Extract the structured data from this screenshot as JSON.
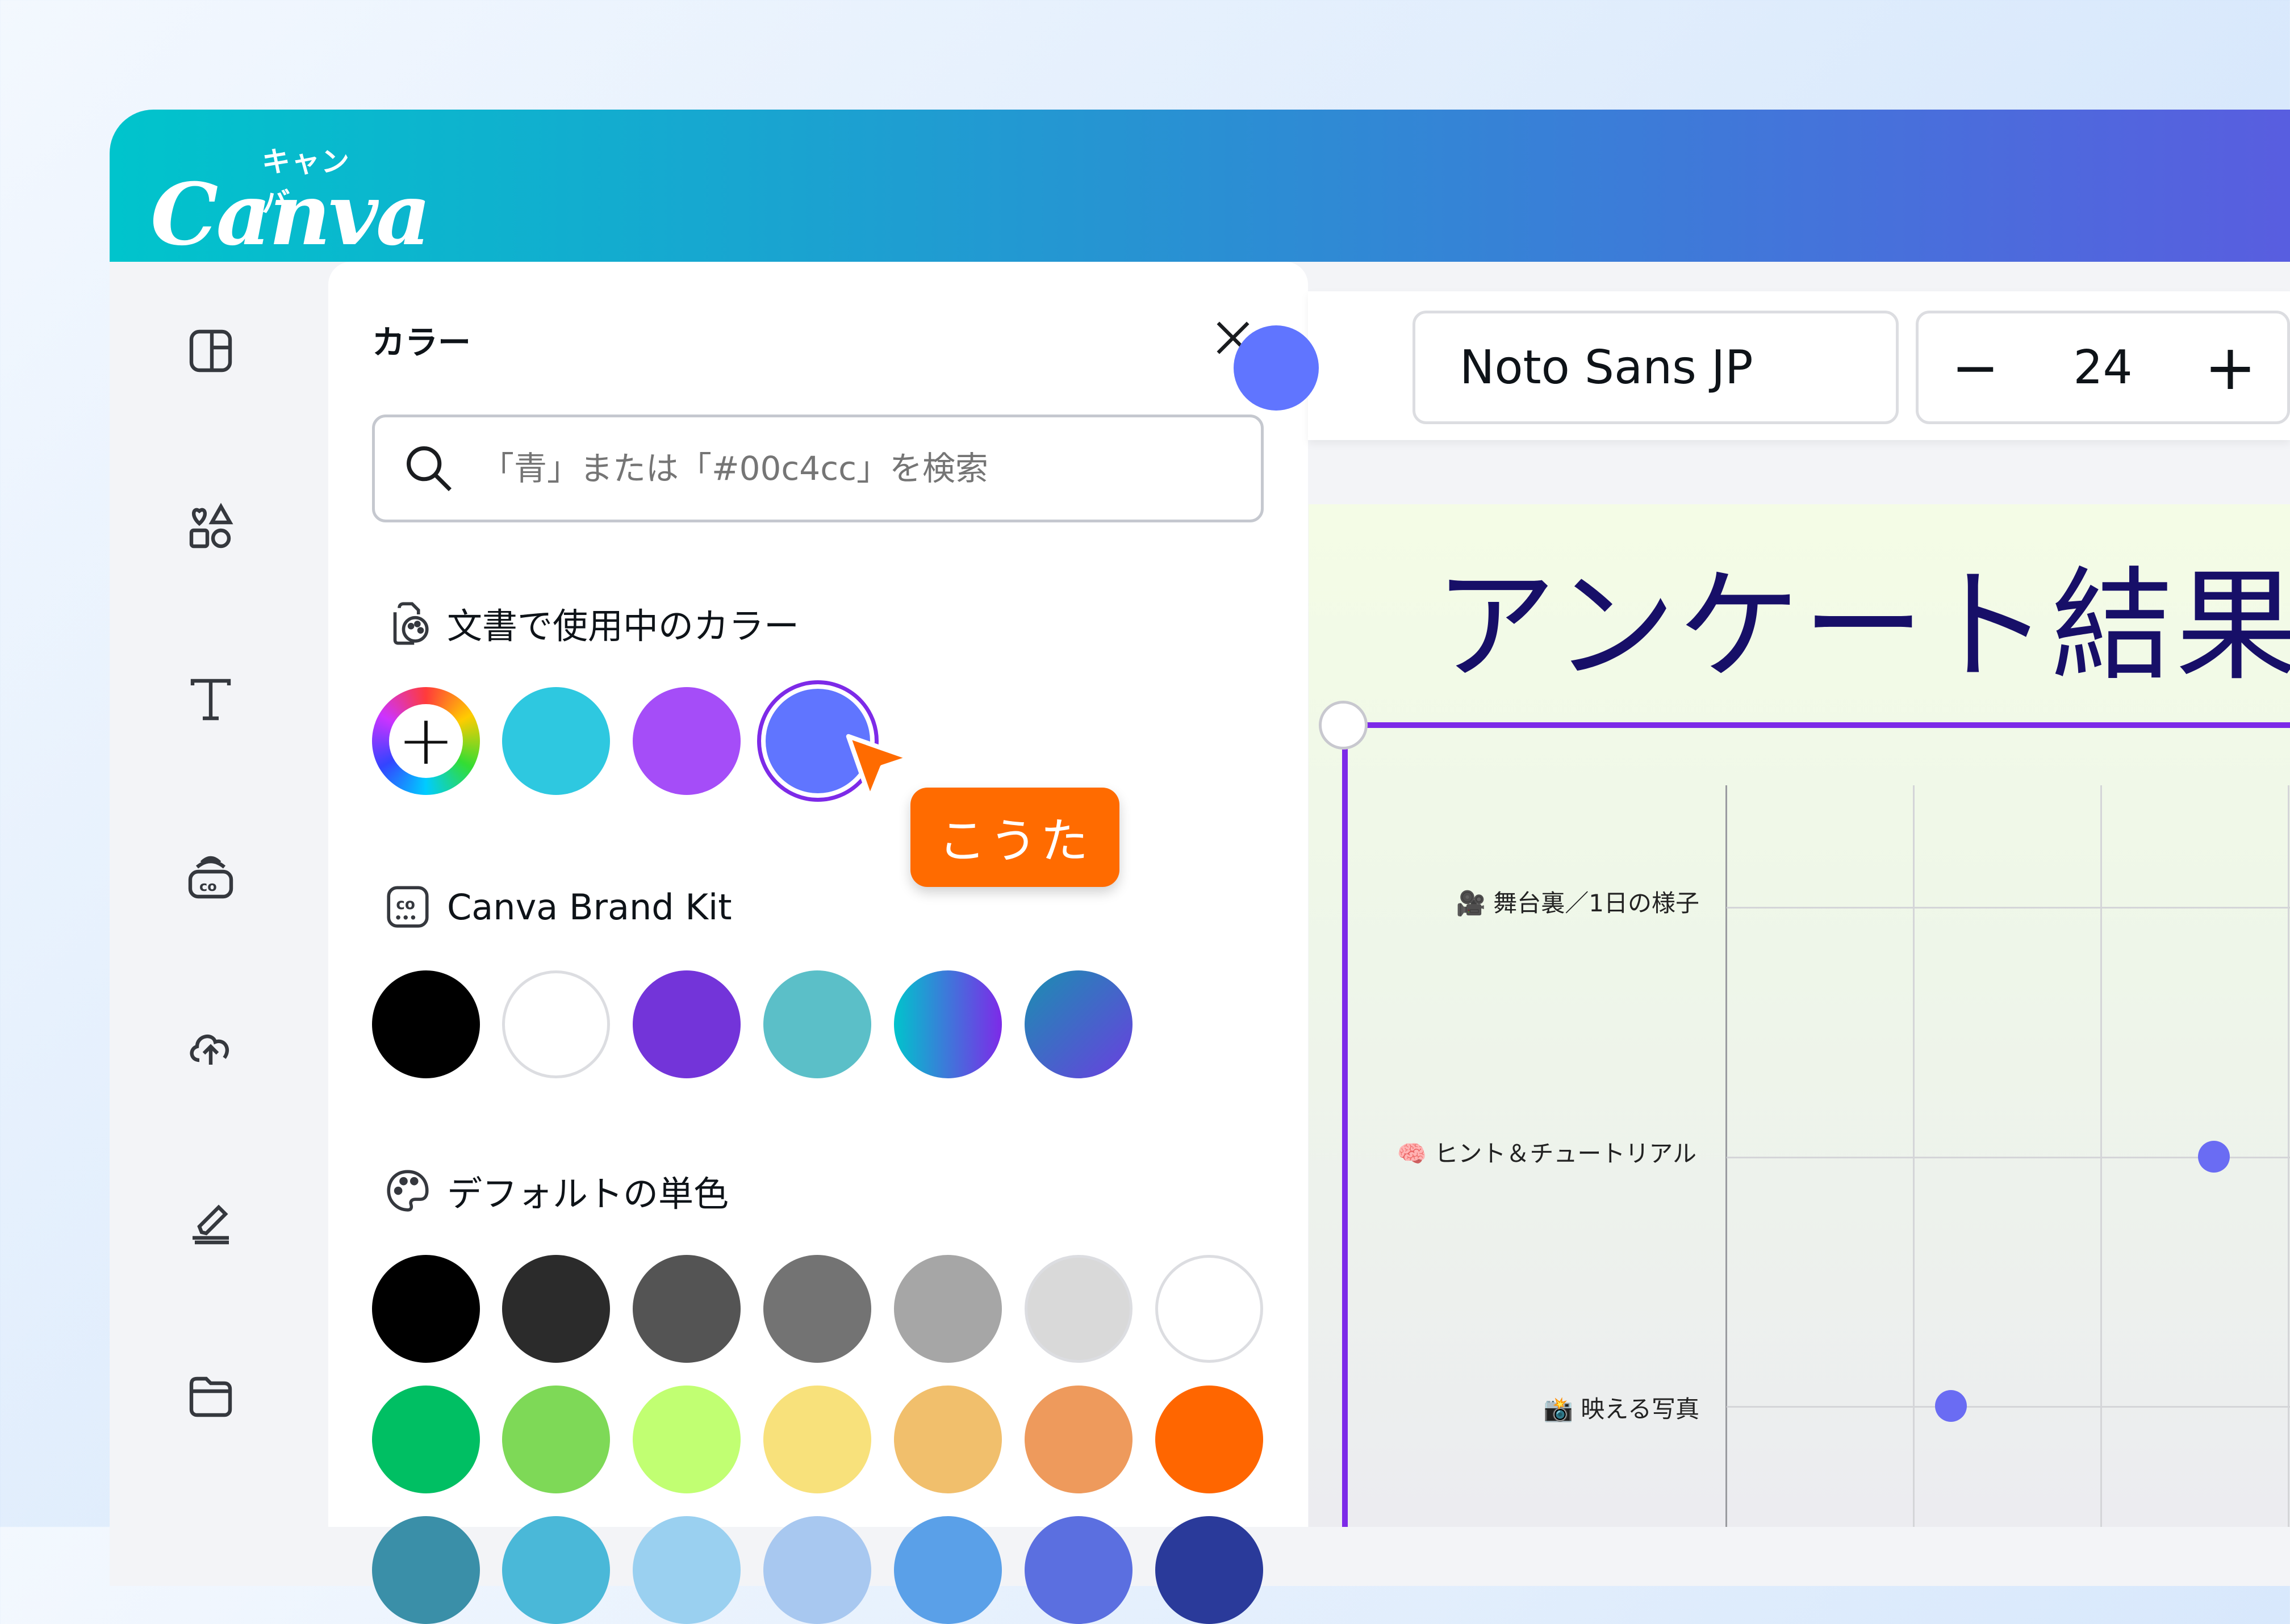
{
  "brand": {
    "logo_text": "Canva",
    "logo_sub": "キャンバ"
  },
  "rail": {
    "icons": [
      "layout-icon",
      "elements-icon",
      "text-icon",
      "brand-icon",
      "uploads-icon",
      "draw-icon",
      "projects-icon"
    ]
  },
  "panel": {
    "title": "カラー",
    "close_icon": "close-icon",
    "search": {
      "placeholder": "「青」または「#00c4cc」を検索",
      "value": ""
    },
    "sections": {
      "doc_colors": {
        "label": "文書で使用中のカラー",
        "colors": [
          "#2ec8e0",
          "#a54df8",
          "#6075ff"
        ],
        "selected": "#6075ff"
      },
      "brand_kit": {
        "label": "Canva Brand Kit",
        "colors": [
          "#000000",
          "#ffffff",
          "#7334d9",
          "#5bbfc8",
          "gradient-cyan-purple",
          "gradient-teal-purple"
        ]
      },
      "default_solid": {
        "label": "デフォルトの単色",
        "row1": [
          "#000000",
          "#2b2b2b",
          "#545454",
          "#737373",
          "#a6a6a6",
          "#d9d9d9",
          "#ffffff"
        ],
        "row2": [
          "#00bf63",
          "#7ed957",
          "#c1ff72",
          "#f8e17b",
          "#f1bf6c",
          "#ee9a5c",
          "#ff6600"
        ]
      }
    }
  },
  "tooltip": {
    "label": "こうた",
    "color": "#ff6b00"
  },
  "toolbar": {
    "text_color": "#6075ff",
    "font_name": "Noto Sans JP",
    "font_size": "24",
    "minus": "−",
    "plus": "+"
  },
  "canvas": {
    "title": "アンケート結果",
    "rows": [
      "🎥 舞台裏／1日の様子",
      "🧠 ヒント＆チュートリアル",
      "📸 映える写真"
    ]
  }
}
